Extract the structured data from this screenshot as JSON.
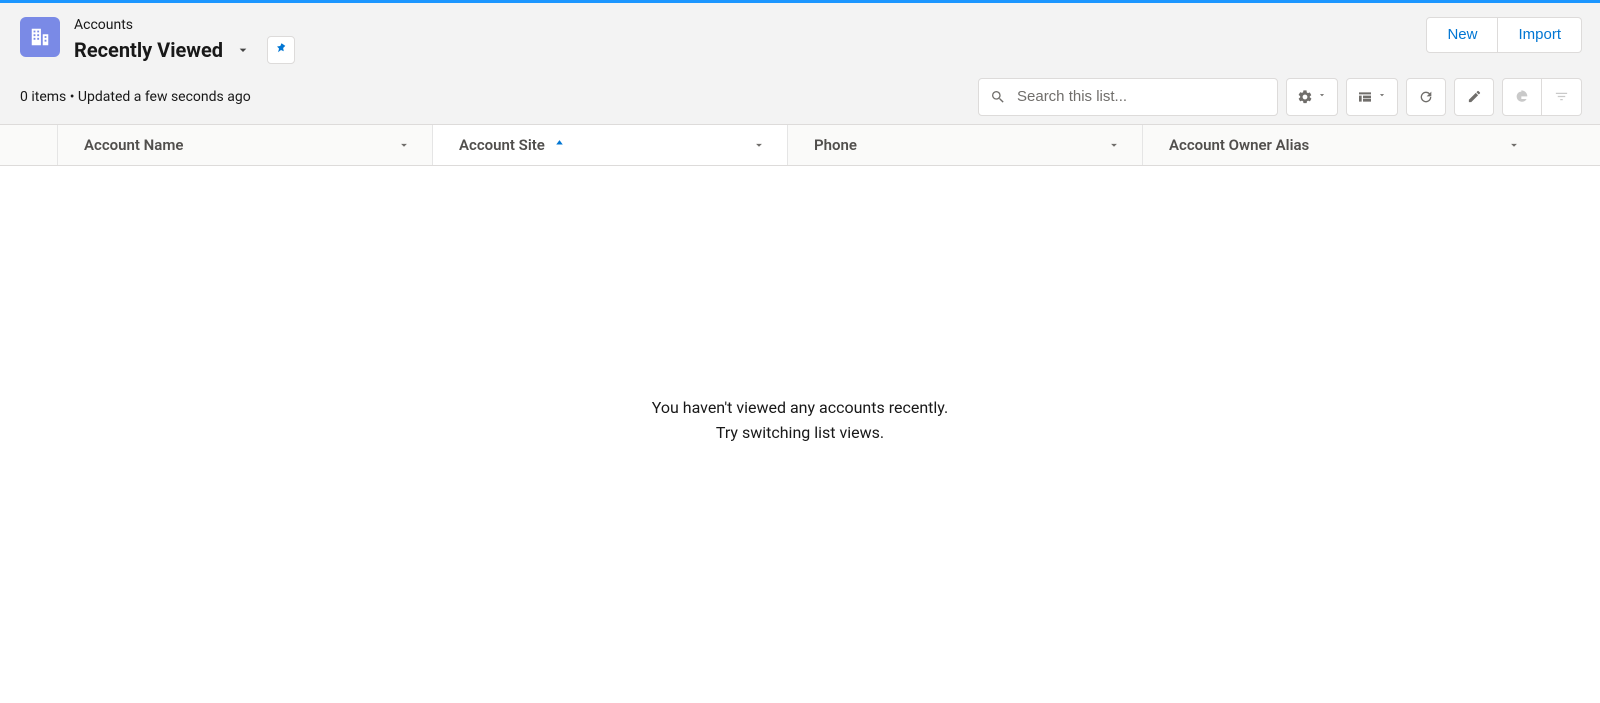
{
  "header": {
    "object_label": "Accounts",
    "list_view_name": "Recently Viewed"
  },
  "actions": {
    "new_label": "New",
    "import_label": "Import"
  },
  "meta": {
    "status_text": "0 items • Updated a few seconds ago"
  },
  "search": {
    "placeholder": "Search this list..."
  },
  "columns": [
    {
      "label": "Account Name",
      "sorted": false
    },
    {
      "label": "Account Site",
      "sorted": true,
      "direction": "asc"
    },
    {
      "label": "Phone",
      "sorted": false
    },
    {
      "label": "Account Owner Alias",
      "sorted": false
    }
  ],
  "empty_state": {
    "line1": "You haven't viewed any accounts recently.",
    "line2": "Try switching list views."
  },
  "item_count": 0
}
